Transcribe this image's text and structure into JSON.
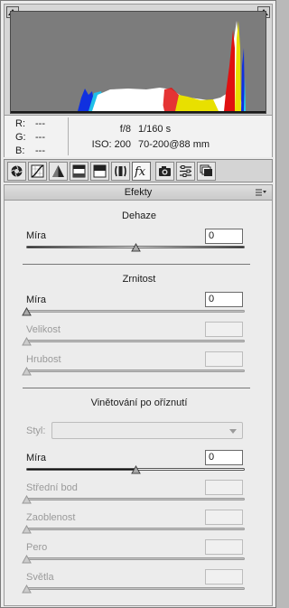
{
  "info": {
    "r_label": "R:",
    "g_label": "G:",
    "b_label": "B:",
    "r_value": "---",
    "g_value": "---",
    "b_value": "---",
    "aperture": "f/8",
    "shutter": "1/160 s",
    "iso": "ISO: 200",
    "lens": "70-200@88 mm"
  },
  "toolbar": {
    "tabs": [
      "basic-icon",
      "tone-curve-icon",
      "detail-icon",
      "hsl-icon",
      "split-toning-icon",
      "lens-corrections-icon",
      "effects-icon",
      "camera-calibration-icon",
      "presets-icon",
      "snapshots-icon"
    ],
    "active": "effects-icon"
  },
  "panel": {
    "title": "Efekty",
    "dehaze": {
      "title": "Dehaze",
      "amount_label": "Míra",
      "amount_value": "0",
      "slider_position": 0.5
    },
    "grain": {
      "title": "Zrnitost",
      "amount_label": "Míra",
      "amount_value": "0",
      "amount_position": 0.0,
      "size_label": "Velikost",
      "size_value": "",
      "size_position": 0.0,
      "roughness_label": "Hrubost",
      "roughness_value": "",
      "roughness_position": 0.0
    },
    "vignette": {
      "title": "Vinětování po oříznutí",
      "style_label": "Styl:",
      "style_value": "",
      "amount_label": "Míra",
      "amount_value": "0",
      "amount_position": 0.5,
      "midpoint_label": "Střední bod",
      "midpoint_value": "",
      "midpoint_position": 0.0,
      "roundness_label": "Zaoblenost",
      "roundness_value": "",
      "roundness_position": 0.0,
      "feather_label": "Pero",
      "feather_value": "",
      "feather_position": 0.0,
      "highlights_label": "Světla",
      "highlights_value": "",
      "highlights_position": 0.0
    }
  },
  "colors": {
    "accent_red": "#e01010",
    "accent_yellow": "#e8e000",
    "accent_blue": "#1030e0",
    "accent_cyan": "#20d0f0"
  }
}
